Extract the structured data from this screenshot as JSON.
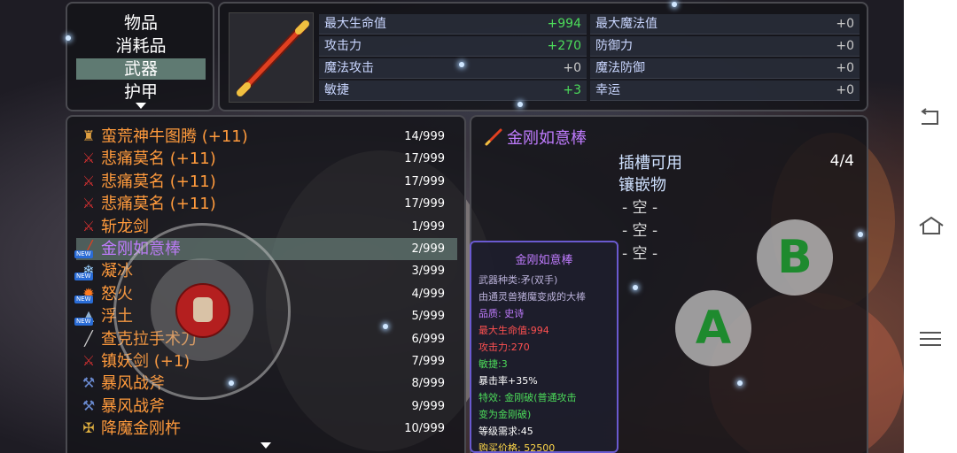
{
  "categories": {
    "items": [
      "物品",
      "消耗品",
      "武器",
      "护甲"
    ],
    "selected_index": 2
  },
  "stats": {
    "left": [
      {
        "label": "最大生命值",
        "value": "+994"
      },
      {
        "label": "攻击力",
        "value": "+270"
      },
      {
        "label": "魔法攻击",
        "value": "+0"
      },
      {
        "label": "敏捷",
        "value": "+3"
      }
    ],
    "right": [
      {
        "label": "最大魔法值",
        "value": "+0"
      },
      {
        "label": "防御力",
        "value": "+0"
      },
      {
        "label": "魔法防御",
        "value": "+0"
      },
      {
        "label": "幸运",
        "value": "+0"
      }
    ]
  },
  "items": [
    {
      "icon": "totem-icon",
      "name": "蛮荒神牛图腾 (+11)",
      "count": "14/999",
      "new": false
    },
    {
      "icon": "sword-icon",
      "name": "悲痛莫名 (+11)",
      "count": "17/999",
      "new": false
    },
    {
      "icon": "sword-icon",
      "name": "悲痛莫名 (+11)",
      "count": "17/999",
      "new": false
    },
    {
      "icon": "sword-icon",
      "name": "悲痛莫名 (+11)",
      "count": "17/999",
      "new": false
    },
    {
      "icon": "sword-icon",
      "name": "斩龙剑",
      "count": "1/999",
      "new": false
    },
    {
      "icon": "staff-icon",
      "name": "金刚如意棒",
      "count": "2/999",
      "new": true
    },
    {
      "icon": "ice-icon",
      "name": "凝冰",
      "count": "3/999",
      "new": true
    },
    {
      "icon": "fire-icon",
      "name": "怒火",
      "count": "4/999",
      "new": true
    },
    {
      "icon": "earth-icon",
      "name": "浮土",
      "count": "5/999",
      "new": true
    },
    {
      "icon": "knife-icon",
      "name": "查克拉手术刀",
      "count": "6/999",
      "new": false
    },
    {
      "icon": "sword-icon",
      "name": "镇妖剑 (+1)",
      "count": "7/999",
      "new": false
    },
    {
      "icon": "axe-icon",
      "name": "暴风战斧",
      "count": "8/999",
      "new": false
    },
    {
      "icon": "axe-icon",
      "name": "暴风战斧",
      "count": "9/999",
      "new": false
    },
    {
      "icon": "vajra-icon",
      "name": "降魔金刚杵",
      "count": "10/999",
      "new": false
    }
  ],
  "selected_item_index": 5,
  "new_label": "NEW",
  "detail": {
    "title": "金刚如意棒",
    "slot_label_1": "插槽可用",
    "slot_label_2": "镶嵌物",
    "slot_count": "4/4",
    "empty_slots": [
      "- 空 -",
      "- 空 -",
      "- 空 -"
    ]
  },
  "tooltip": {
    "title": "金刚如意棒",
    "lines": [
      {
        "text": "武器种类:矛(双手)",
        "color": "#b9b0d8"
      },
      {
        "text": "由通灵兽猪魔变成的大棒",
        "color": "#b9b0d8"
      },
      {
        "text": "品质: 史诗",
        "color": "#c07cff"
      },
      {
        "text": "最大生命值:994",
        "color": "#ff5050"
      },
      {
        "text": "攻击力:270",
        "color": "#ff5050"
      },
      {
        "text": "敏捷:3",
        "color": "#4cdc5a"
      },
      {
        "text": "暴击率+35%",
        "color": "#ffffff"
      },
      {
        "text": "特效: 金刚破(普通攻击",
        "color": "#4cdc5a"
      },
      {
        "text": "变为金刚破)",
        "color": "#4cdc5a"
      },
      {
        "text": "等级需求:45",
        "color": "#ffffff"
      },
      {
        "text": "购买价格: 52500",
        "color": "#ffd84a"
      }
    ]
  },
  "buttons": {
    "a": "A",
    "b": "B"
  },
  "colors": {
    "item_name": "#ff9a3c",
    "epic": "#c07cff",
    "bonus": "#4cdc5a",
    "button_letter": "#1e8a2e"
  }
}
